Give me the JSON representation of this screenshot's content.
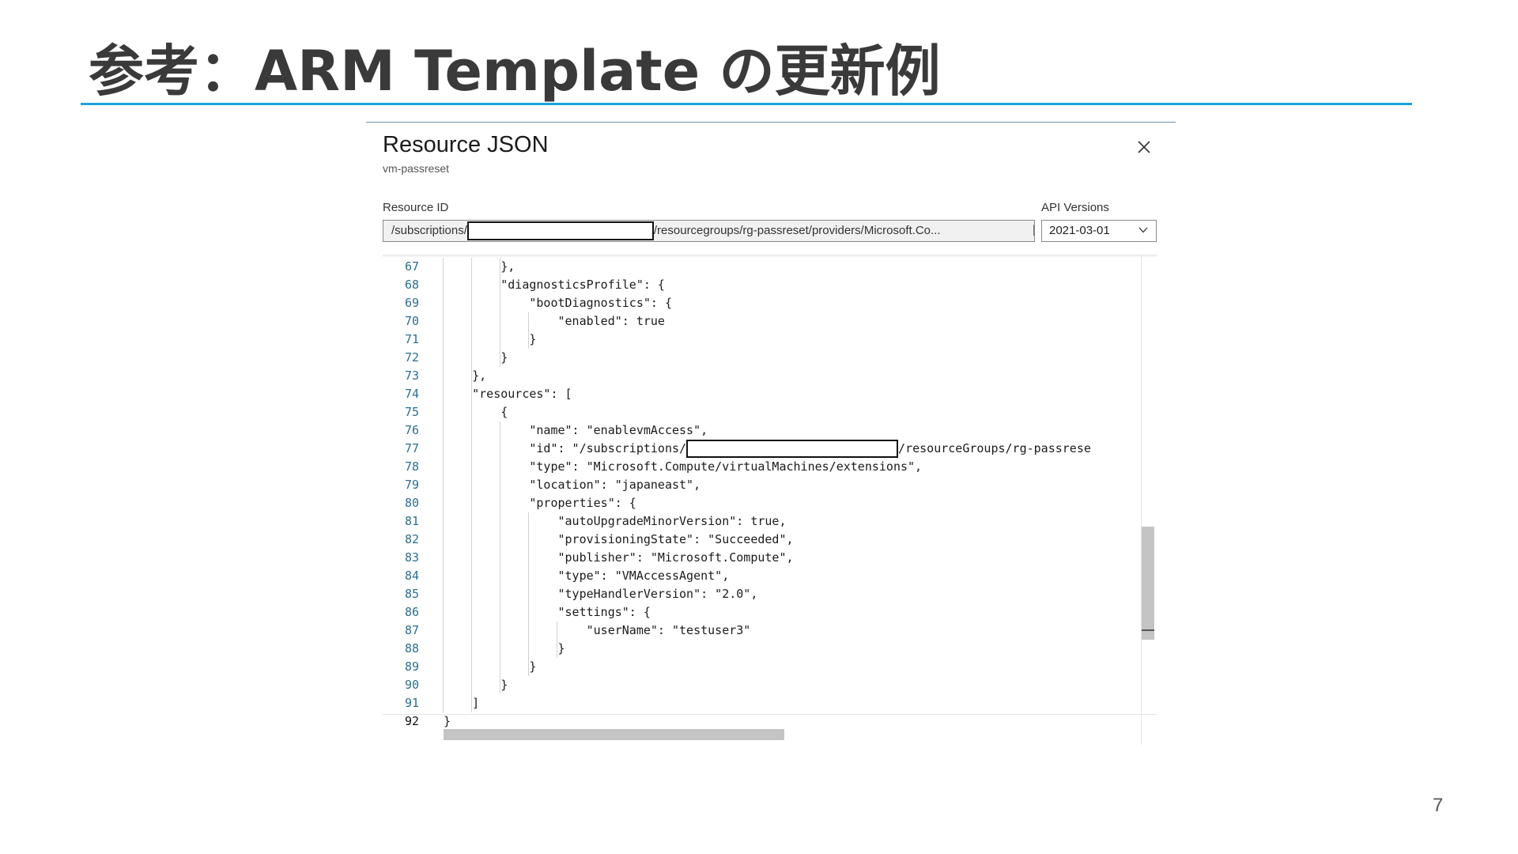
{
  "slide": {
    "title": "参考：ARM Template の更新例",
    "page_number": "7"
  },
  "panel": {
    "title": "Resource JSON",
    "subtitle": "vm-passreset",
    "close_icon": "close-icon",
    "resource_id_label": "Resource ID",
    "resource_id_prefix": "/subscriptions/",
    "resource_id_suffix": "/resourcegroups/rg-passreset/providers/Microsoft.Co...",
    "copy_icon": "copy-icon",
    "api_versions_label": "API Versions",
    "api_version_selected": "2021-03-01",
    "chevron_icon": "chevron-down-icon"
  },
  "editor": {
    "lines": [
      {
        "n": "67",
        "text": "        },"
      },
      {
        "n": "68",
        "text": "        \"diagnosticsProfile\": {"
      },
      {
        "n": "69",
        "text": "            \"bootDiagnostics\": {"
      },
      {
        "n": "70",
        "text": "                \"enabled\": true"
      },
      {
        "n": "71",
        "text": "            }"
      },
      {
        "n": "72",
        "text": "        }"
      },
      {
        "n": "73",
        "text": "    },"
      },
      {
        "n": "74",
        "text": "    \"resources\": ["
      },
      {
        "n": "75",
        "text": "        {"
      },
      {
        "n": "76",
        "text": "            \"name\": \"enablevmAccess\","
      },
      {
        "n": "77",
        "text": "            \"id\": \"/subscriptions/",
        "after_redact": "/resourceGroups/rg-passrese"
      },
      {
        "n": "78",
        "text": "            \"type\": \"Microsoft.Compute/virtualMachines/extensions\","
      },
      {
        "n": "79",
        "text": "            \"location\": \"japaneast\","
      },
      {
        "n": "80",
        "text": "            \"properties\": {"
      },
      {
        "n": "81",
        "text": "                \"autoUpgradeMinorVersion\": true,"
      },
      {
        "n": "82",
        "text": "                \"provisioningState\": \"Succeeded\","
      },
      {
        "n": "83",
        "text": "                \"publisher\": \"Microsoft.Compute\","
      },
      {
        "n": "84",
        "text": "                \"type\": \"VMAccessAgent\","
      },
      {
        "n": "85",
        "text": "                \"typeHandlerVersion\": \"2.0\","
      },
      {
        "n": "86",
        "text": "                \"settings\": {"
      },
      {
        "n": "87",
        "text": "                    \"userName\": \"testuser3\""
      },
      {
        "n": "88",
        "text": "                }"
      },
      {
        "n": "89",
        "text": "            }"
      },
      {
        "n": "90",
        "text": "        }"
      },
      {
        "n": "91",
        "text": "    ]"
      },
      {
        "n": "92",
        "text": "}"
      }
    ]
  }
}
